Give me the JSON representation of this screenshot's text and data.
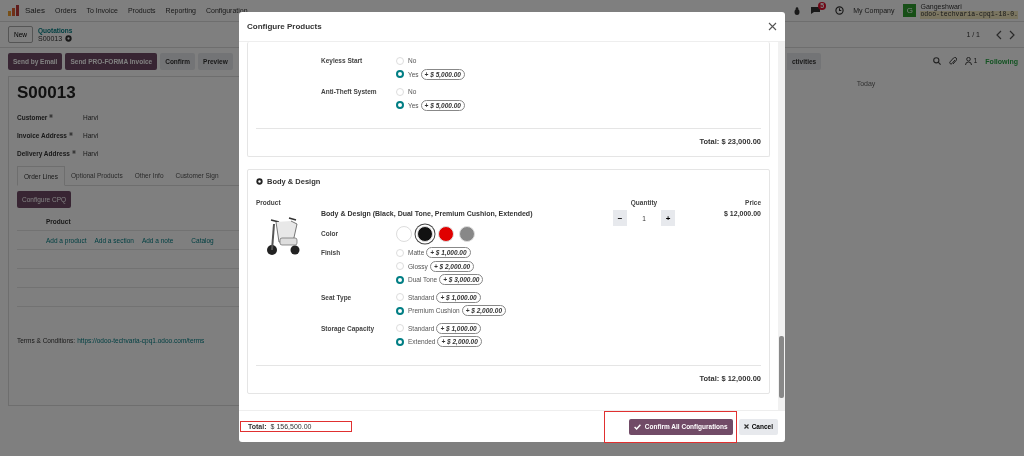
{
  "navbar": {
    "app": "Sales",
    "menu": [
      "Orders",
      "To Invoice",
      "Products",
      "Reporting",
      "Configuration"
    ],
    "message_count": "5",
    "company": "My Company",
    "avatar_letter": "G",
    "user": "Gangeshwari",
    "database": "odoo-techvaria-cpq1-18-0."
  },
  "control_panel": {
    "new_button": "New",
    "parent": "Quotations",
    "current": "S00013",
    "pager": "1 / 1"
  },
  "actions": [
    {
      "label": "Send by Email",
      "kind": "primary"
    },
    {
      "label": "Send PRO-FORMA Invoice",
      "kind": "primary"
    },
    {
      "label": "Confirm",
      "kind": "secondary"
    },
    {
      "label": "Preview",
      "kind": "secondary"
    }
  ],
  "chatter": {
    "activities": "ctivities",
    "follower_count": "1",
    "following": "Following",
    "date": "Today"
  },
  "form": {
    "title": "S00013",
    "fields": [
      {
        "label": "Customer",
        "required": true,
        "value": "Harvi"
      },
      {
        "label": "Invoice Address",
        "required": true,
        "value": "Harvi"
      },
      {
        "label": "Delivery Address",
        "required": true,
        "value": "Harvi"
      }
    ],
    "tabs": [
      {
        "label": "Order Lines",
        "selected": true
      },
      {
        "label": "Optional Products",
        "selected": false
      },
      {
        "label": "Other Info",
        "selected": false
      },
      {
        "label": "Customer Sign",
        "selected": false
      }
    ],
    "cpq_button": "Configure CPQ",
    "columns": [
      "Product"
    ],
    "links": [
      "Add a product",
      "Add a section",
      "Add a note",
      "Catalog"
    ],
    "terms_label": "Terms & Conditions:",
    "terms_link": "https://odoo-techvaria-cpq1.odoo.com/terms"
  },
  "dialog": {
    "title": "Configure Products",
    "sections": [
      {
        "attributes": [
          {
            "name": "Keyless Start",
            "kind": "radio",
            "options": [
              {
                "label": "No",
                "selected": false
              },
              {
                "label": "Yes",
                "extra": "+ $ 5,000.00",
                "selected": true
              }
            ]
          },
          {
            "name": "Anti-Theft System",
            "kind": "radio",
            "options": [
              {
                "label": "No",
                "selected": false
              },
              {
                "label": "Yes",
                "extra": "+ $ 5,000.00",
                "selected": true
              }
            ]
          }
        ],
        "total": "Total: $ 23,000.00"
      },
      {
        "title": "Body & Design",
        "columns": [
          "Product",
          "Quantity",
          "Price"
        ],
        "product": {
          "name": "Body & Design (Black, Dual Tone, Premium Cushion, Extended)",
          "decrement": "−",
          "quantity": "1",
          "increment": "+",
          "price": "$ 12,000.00"
        },
        "attributes": [
          {
            "name": "Color",
            "kind": "swatch",
            "options": [
              {
                "color": "#ffffff",
                "selected": false
              },
              {
                "color": "#111111",
                "selected": true
              },
              {
                "color": "#e00000",
                "selected": false
              },
              {
                "color": "#888888",
                "selected": false
              }
            ]
          },
          {
            "name": "Finish",
            "kind": "radio",
            "options": [
              {
                "label": "Matte",
                "extra": "+ $ 1,000.00",
                "selected": false
              },
              {
                "label": "Glossy",
                "extra": "+ $ 2,000.00",
                "selected": false
              },
              {
                "label": "Dual Tone",
                "extra": "+ $ 3,000.00",
                "selected": true
              }
            ]
          },
          {
            "name": "Seat Type",
            "kind": "radio",
            "options": [
              {
                "label": "Standard",
                "extra": "+ $ 1,000.00",
                "selected": false
              },
              {
                "label": "Premium Cushion",
                "extra": "+ $ 2,000.00",
                "selected": true
              }
            ]
          },
          {
            "name": "Storage Capacity",
            "kind": "radio",
            "options": [
              {
                "label": "Standard",
                "extra": "+ $ 1,000.00",
                "selected": false
              },
              {
                "label": "Extended",
                "extra": "+ $ 2,000.00",
                "selected": true
              }
            ]
          }
        ],
        "total": "Total: $ 12,000.00"
      }
    ],
    "footer": {
      "total_label": "Total:",
      "total": "$ 156,500.00",
      "confirm": "Confirm All Configurations",
      "cancel": "Cancel",
      "highlight_total": true,
      "highlight_confirm": true
    }
  }
}
